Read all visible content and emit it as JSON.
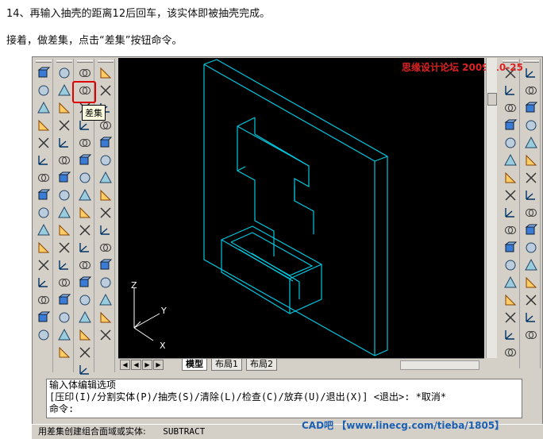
{
  "instructions": {
    "line1": "14、再输入抽壳的距离12后回车，该实体即被抽壳完成。",
    "line2": "接着，做差集，点击“差集”按钮命令。"
  },
  "tooltip": {
    "label": "差集"
  },
  "watermarks": {
    "top": "思缘设计论坛 2009-10-25",
    "bottom": "CAD吧 【www.linecg.com/tieba/1805】"
  },
  "tabs": [
    {
      "label": "模型",
      "active": true
    },
    {
      "label": "布局1",
      "active": false
    },
    {
      "label": "布局2",
      "active": false
    }
  ],
  "axes": {
    "x": "X",
    "y": "Y",
    "z": "Z"
  },
  "command_lines": [
    "输入体编辑选项",
    "[压印(I)/分割实体(P)/抽壳(S)/清除(L)/检查(C)/放弃(U)/退出(X)] <退出>: *取消*",
    "命令:"
  ],
  "status": {
    "text": "用差集创建组合面域或实体:",
    "command": "SUBTRACT"
  },
  "colors": {
    "model_wire": "#00c8e0",
    "highlight": "#e00000",
    "tooltip_bg": "#ffffe1"
  },
  "icons": {
    "col1": [
      "ucs-icon",
      "ucs-world-icon",
      "ucs-previous-icon",
      "ucs-object-icon",
      "ucs-face-icon",
      "ucs-view-icon",
      "ucs-origin-icon",
      "ucs-zaxis-icon",
      "ucs-3point-icon",
      "ucs-x-icon",
      "ucs-y-icon",
      "ucs-z-icon",
      "ucs-apply-icon",
      "named-ucs-icon",
      "ucs-settings-icon",
      "ucs-move-icon"
    ],
    "col2": [
      "box-solid-icon",
      "wedge-icon",
      "extrude-icon",
      "revolve-icon",
      "slice-icon",
      "section-icon",
      "interfere-icon",
      "setup-drawing-icon",
      "setup-view-icon",
      "setup-profile-icon",
      "orbit-icon",
      "camera-icon",
      "pan-icon",
      "zoom-icon",
      "render-icon",
      "materials-icon",
      "lights-icon"
    ],
    "col3": [
      "union-icon",
      "subtract-icon",
      "intersect-icon",
      "extrude-faces-icon",
      "move-faces-icon",
      "offset-faces-icon",
      "delete-faces-icon",
      "rotate-faces-icon",
      "taper-faces-icon",
      "copy-faces-icon",
      "color-faces-icon",
      "copy-edges-icon",
      "color-edges-icon",
      "imprint-icon",
      "clean-icon",
      "separate-icon",
      "shell-icon",
      "check-icon"
    ],
    "col4": [
      "box-icon",
      "sphere-icon",
      "cylinder-icon",
      "cone-icon",
      "wedge-solid-icon",
      "torus-icon",
      "box-mesh-icon",
      "pyramid-icon",
      "dome-icon",
      "dish-icon",
      "mesh-icon",
      "3dface-icon",
      "revsurf-icon",
      "edgesurf-icon",
      "tabsurf-icon",
      "rulesurf-icon"
    ],
    "draw": [
      "line-icon",
      "xline-icon",
      "pline-icon",
      "polygon-icon",
      "rectangle-icon",
      "arc-icon",
      "circle-icon",
      "revcloud-icon",
      "spline-icon",
      "ellipse-icon",
      "ellipse-arc-icon",
      "insert-block-icon",
      "make-block-icon",
      "point-icon",
      "hatch-icon",
      "region-icon",
      "mtext-icon"
    ],
    "modify": [
      "erase-icon",
      "copy-icon",
      "mirror-icon",
      "offset-icon",
      "array-icon",
      "move-icon",
      "rotate-icon",
      "scale-icon",
      "stretch-icon",
      "trim-icon",
      "extend-icon",
      "break-icon",
      "join-icon",
      "chamfer-icon",
      "fillet-icon",
      "explode-icon"
    ]
  }
}
